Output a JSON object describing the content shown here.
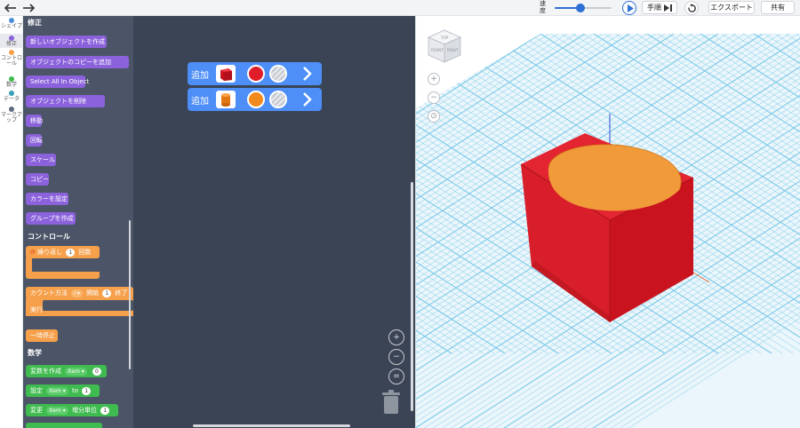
{
  "topbar": {
    "speed_label": "速度",
    "speed_fraction": 0.45,
    "step_label": "手順",
    "export_label": "エクスポート",
    "share_label": "共有"
  },
  "rail": {
    "items": [
      {
        "label": "シェイプ",
        "color": "#4a90d9"
      },
      {
        "label": "修正",
        "color": "#8b62db"
      },
      {
        "label": "コントロール",
        "color": "#f6a04b"
      },
      {
        "label": "数学",
        "color": "#3fbb4f"
      },
      {
        "label": "データ",
        "color": "#37a0b8"
      },
      {
        "label": "マークアップ",
        "color": "#5c6a7e"
      }
    ]
  },
  "palette": {
    "section_modify": "修正",
    "modify_blocks": [
      "新しいオブジェクトを作成",
      "オブジェクトのコピーを追加",
      "Select All In Object",
      "オブジェクトを削除",
      "移動",
      "回転",
      "スケール",
      "コピー",
      "カラーを設定",
      "グループを作成"
    ],
    "section_control": "コントロール",
    "repeat": {
      "label": "繰り返し",
      "count": "1",
      "suffix": "回数"
    },
    "count_with": {
      "label": "カウント方法",
      "var": "i",
      "start_label": "開始",
      "start": "1",
      "end_label": "終了"
    },
    "do_label": "実行",
    "pause_label": "一時停止",
    "section_math": "数学",
    "create_var": {
      "label": "変数を作成",
      "var": "item",
      "value": "0"
    },
    "set_var": {
      "label": "設定",
      "var": "item",
      "to": "to",
      "value": "1"
    },
    "change_var": {
      "label": "変更",
      "var": "item",
      "by": "増分単位",
      "value": "1"
    }
  },
  "workspace": {
    "blocks": [
      {
        "label": "追加",
        "shape": "cube-thumbnail",
        "color": "#e01e2b"
      },
      {
        "label": "追加",
        "shape": "cylinder-thumbnail",
        "color": "#f08a1c"
      }
    ]
  },
  "viewport": {
    "view_cube_labels": [
      "TOP",
      "FRONT",
      "RIGHT"
    ],
    "colors": {
      "cube": "#e01e2b",
      "cylinder": "#f08a1c",
      "grid": "#6fc3e6"
    }
  }
}
